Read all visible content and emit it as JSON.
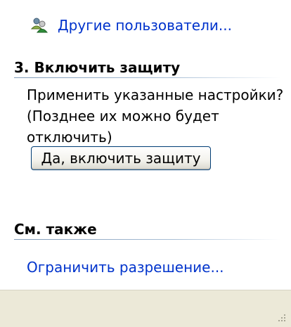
{
  "users_link": {
    "label": "Другие пользователи...",
    "icon": "users-icon"
  },
  "section3": {
    "title": "3. Включить защиту",
    "description_lines": [
      "Применить указанные настройки?",
      "(Позднее их можно будет",
      "отключить)"
    ],
    "button_label": "Да, включить защиту"
  },
  "see_also": {
    "title": "См. также",
    "link_label": "Ограничить разрешение..."
  },
  "colors": {
    "link": "#0033cc",
    "rule": "#7f9ab8",
    "status_bar": "#ece9d8"
  }
}
